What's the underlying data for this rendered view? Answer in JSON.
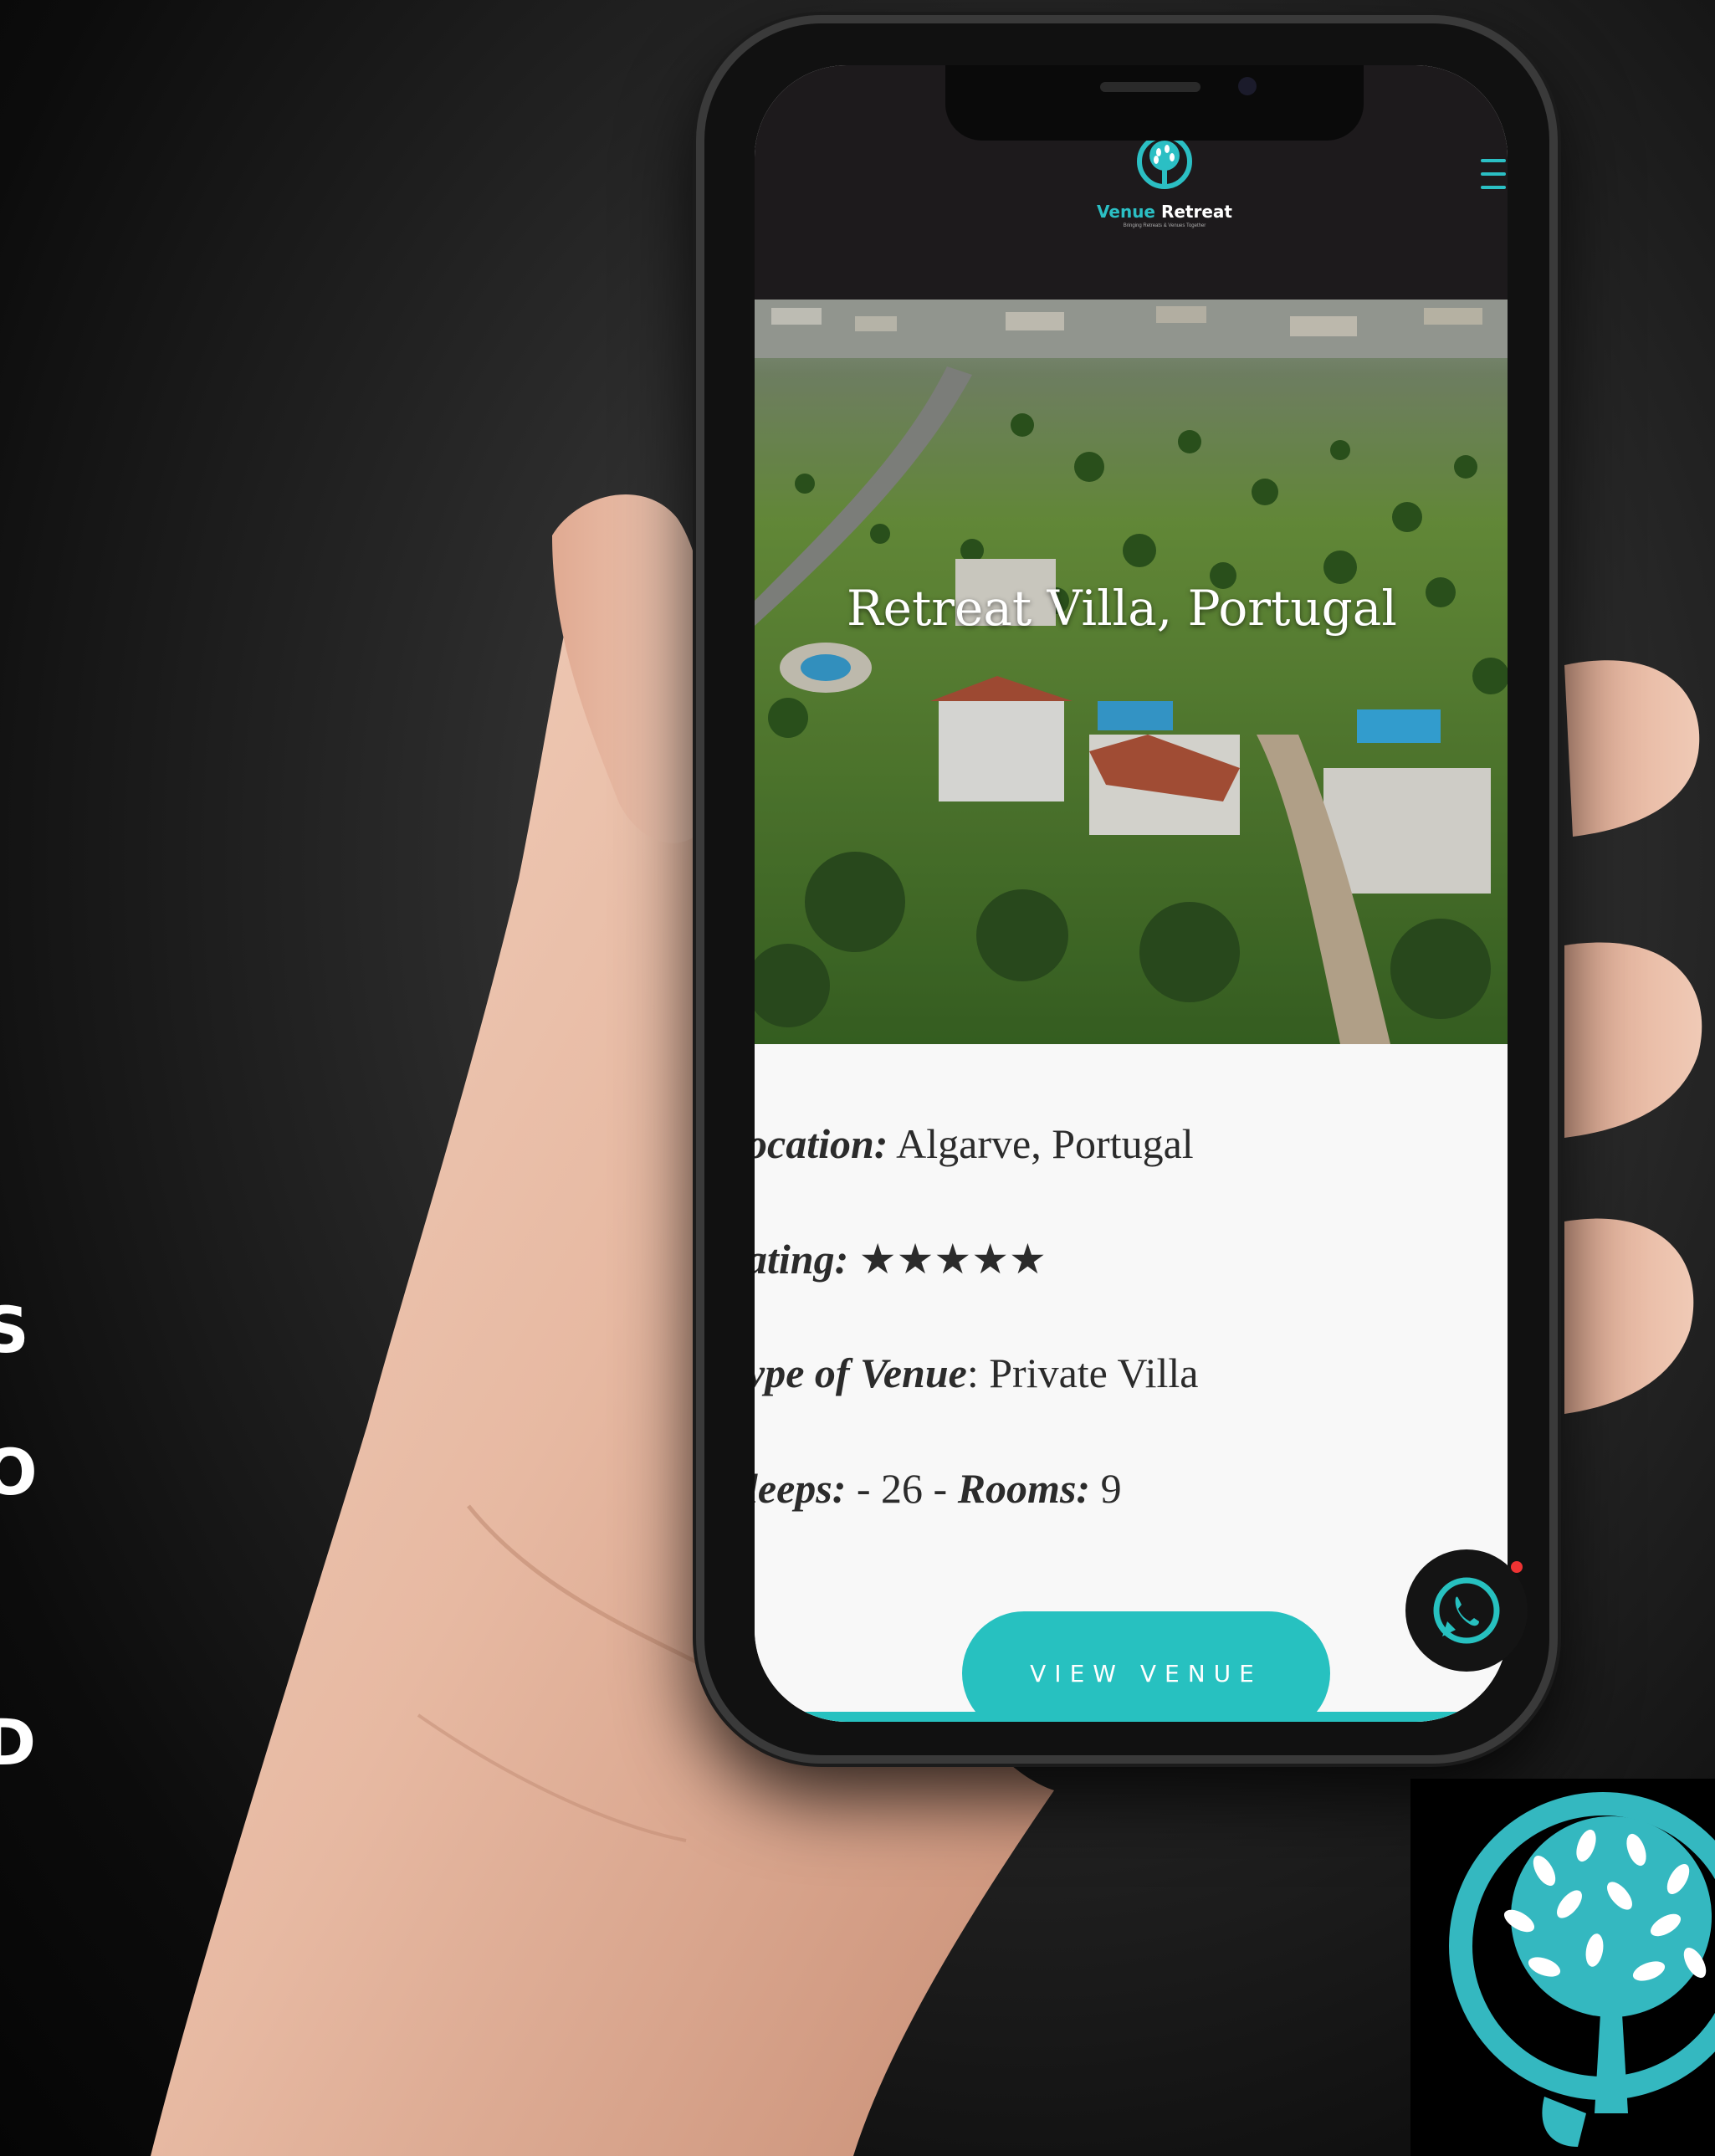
{
  "side_fragments": [
    "S",
    "O",
    "D"
  ],
  "site": {
    "brand_first": "Venue",
    "brand_second": "Retreat",
    "tagline": "Bringing Retreats & Venues Together",
    "menu_icon": "hamburger-menu-icon"
  },
  "hero": {
    "title": "Retreat Villa, Portugal"
  },
  "details": {
    "location_label": "ocation:",
    "location_value": " Algarve, Portugal",
    "rating_label": "ating:",
    "rating_value": " ★★★★★",
    "rating": 5,
    "rating_max": 5,
    "venue_type_label": "ype of Venue",
    "venue_type_value": ": Private Villa",
    "sleeps_label": "leeps:",
    "sleeps_value": " - 26  - ",
    "rooms_label": "Rooms:",
    "rooms_value": " 9"
  },
  "cta": {
    "view_venue": "VIEW VENUE"
  },
  "floating": {
    "whatsapp_icon": "whatsapp-icon"
  },
  "colors": {
    "accent": "#27c1c0",
    "header_bg": "#1d1a1c",
    "content_bg": "#f8f8f8"
  }
}
